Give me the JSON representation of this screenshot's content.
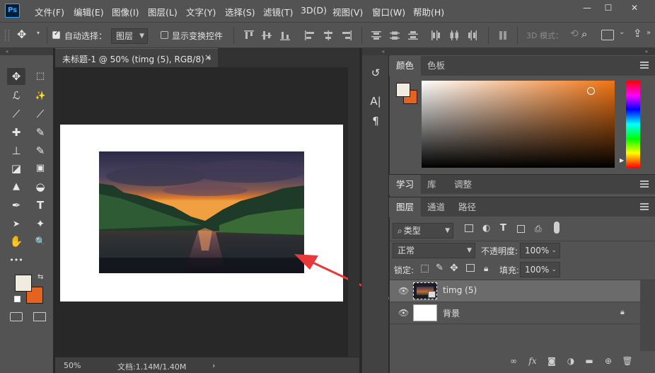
{
  "app": {
    "logo": "Ps"
  },
  "menu": [
    "文件(F)",
    "编辑(E)",
    "图像(I)",
    "图层(L)",
    "文字(Y)",
    "选择(S)",
    "滤镜(T)",
    "3D(D)",
    "视图(V)",
    "窗口(W)",
    "帮助(H)"
  ],
  "window_controls": {
    "minimize": "—",
    "maximize": "☐",
    "close": "✕"
  },
  "options": {
    "auto_select_label": "自动选择：",
    "auto_select_value": "图层",
    "show_transform_label": "显示变换控件",
    "mode_3d_label": "3D 模式："
  },
  "toolbar": {
    "tools": [
      {
        "name": "move-tool",
        "glyph": "✥"
      },
      {
        "name": "marquee-tool",
        "glyph": "⬚"
      },
      {
        "name": "lasso-tool",
        "glyph": "ℒ"
      },
      {
        "name": "magic-wand-tool",
        "glyph": "✨"
      },
      {
        "name": "crop-tool",
        "glyph": "⟋"
      },
      {
        "name": "eyedropper-tool",
        "glyph": "⟋"
      },
      {
        "name": "healing-brush-tool",
        "glyph": "✚"
      },
      {
        "name": "brush-tool",
        "glyph": "✎"
      },
      {
        "name": "clone-stamp-tool",
        "glyph": "⊥"
      },
      {
        "name": "history-brush-tool",
        "glyph": "✎"
      },
      {
        "name": "eraser-tool",
        "glyph": "◪"
      },
      {
        "name": "gradient-tool",
        "glyph": "▣"
      },
      {
        "name": "blur-tool",
        "glyph": "▲"
      },
      {
        "name": "dodge-tool",
        "glyph": "◒"
      },
      {
        "name": "pen-tool",
        "glyph": "✒"
      },
      {
        "name": "type-tool",
        "glyph": "T"
      },
      {
        "name": "path-selection-tool",
        "glyph": "➤"
      },
      {
        "name": "shape-tool",
        "glyph": "✦"
      },
      {
        "name": "hand-tool",
        "glyph": "✋"
      },
      {
        "name": "zoom-tool",
        "glyph": "🔍"
      },
      {
        "name": "more-tools",
        "glyph": "•••"
      }
    ],
    "foreground_color": "#f2ebe0",
    "background_color": "#e3631f"
  },
  "document": {
    "tab_title": "未标题-1 @ 50% (timg (5), RGB/8) *",
    "close_glyph": "×",
    "zoom": "50%",
    "doc_info": "文档:1.14M/1.40M",
    "status_arrow": "›"
  },
  "midcol_icons": [
    {
      "name": "history-icon",
      "glyph": "↺"
    },
    {
      "name": "character-icon",
      "glyph": "A|"
    },
    {
      "name": "paragraph-icon",
      "glyph": "¶"
    }
  ],
  "color_panel": {
    "tabs": [
      "颜色",
      "色板"
    ],
    "foreground": "#f2ebe0",
    "background": "#e3631f",
    "hue_color": "#f07414"
  },
  "learn_panel": {
    "tabs": [
      "学习",
      "库",
      "调整"
    ]
  },
  "layers_panel": {
    "tabs": [
      "图层",
      "通道",
      "路径"
    ],
    "filter_kind": "类型",
    "blend_mode": "正常",
    "opacity_label": "不透明度:",
    "opacity_value": "100%",
    "lock_label": "锁定:",
    "fill_label": "填充:",
    "fill_value": "100%",
    "layers": [
      {
        "name": "timg (5)",
        "selected": true
      },
      {
        "name": "背景",
        "selected": false,
        "locked": true
      }
    ],
    "bottom_icons": [
      "link-layers-icon",
      "fx-icon",
      "mask-icon",
      "adjustment-icon",
      "group-icon",
      "new-layer-icon",
      "delete-icon"
    ]
  }
}
